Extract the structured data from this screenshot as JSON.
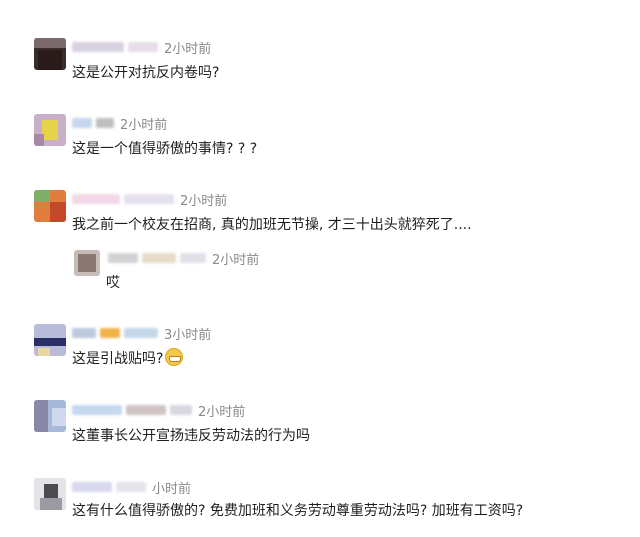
{
  "comments": [
    {
      "time": "2小时前",
      "text": "这是公开对抗反内卷吗?"
    },
    {
      "time": "2小时前",
      "text": "这是一个值得骄傲的事情? ? ?"
    },
    {
      "time": "2小时前",
      "text": "我之前一个校友在招商, 真的加班无节操, 才三十出头就猝死了...."
    },
    {
      "time": "2小时前",
      "text": "哎"
    },
    {
      "time": "3小时前",
      "text": "这是引战贴吗?"
    },
    {
      "time": "2小时前",
      "text": "这董事长公开宣扬违反劳动法的行为吗"
    },
    {
      "time": "小时前",
      "text": "这有什么值得骄傲的? 免费加班和义务劳动尊重劳动法吗? 加班有工资吗?"
    }
  ],
  "icons": {
    "grin_emoji": "grinning-face-emoji"
  }
}
